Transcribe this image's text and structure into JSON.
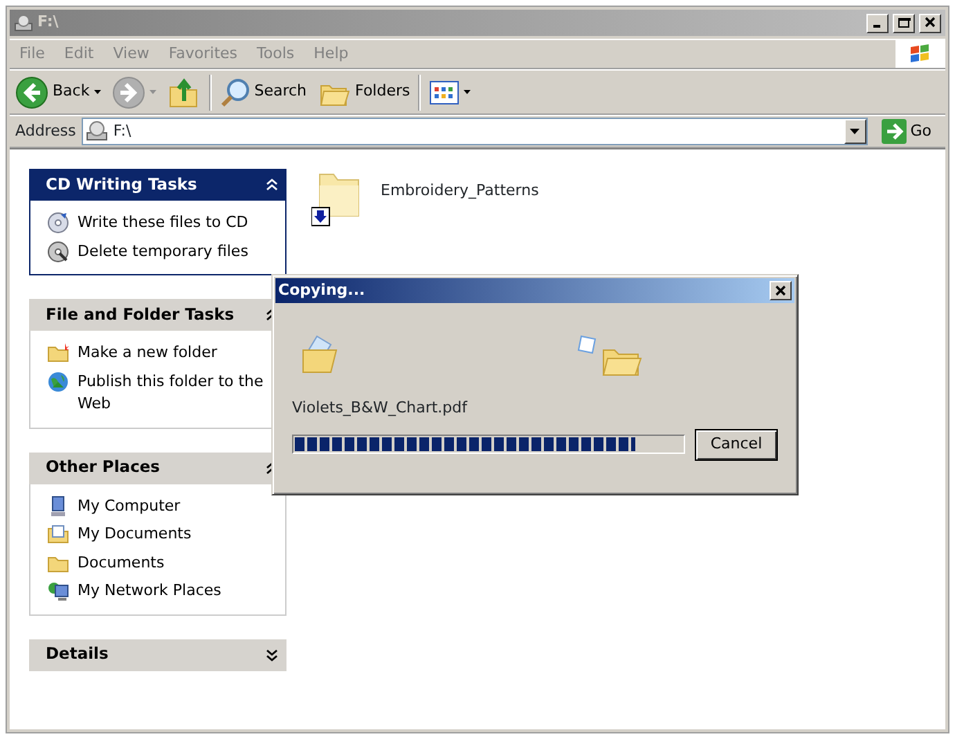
{
  "window": {
    "title": "F:\\",
    "active": false
  },
  "menu": [
    "File",
    "Edit",
    "View",
    "Favorites",
    "Tools",
    "Help"
  ],
  "toolbar": [
    {
      "kind": "back",
      "label": "Back",
      "disabled": false
    },
    {
      "kind": "forward",
      "disabled": true
    },
    {
      "kind": "up"
    },
    {
      "kind": "search",
      "label": "Search"
    },
    {
      "kind": "folders",
      "label": "Folders"
    },
    {
      "kind": "views"
    }
  ],
  "address": {
    "label": "Address",
    "value": "F:\\",
    "go": "Go"
  },
  "panels": [
    {
      "title": "CD Writing Tasks",
      "kind": "special",
      "expanded": true,
      "items": [
        {
          "label": "Write these files to CD"
        },
        {
          "label": "Delete temporary files"
        }
      ]
    },
    {
      "title": "File and Folder Tasks",
      "kind": "normal",
      "expanded": true,
      "items": [
        {
          "label": "Make a new folder"
        },
        {
          "label": "Publish this folder to the Web"
        }
      ]
    },
    {
      "title": "Other Places",
      "kind": "normal",
      "expanded": true,
      "items": [
        {
          "label": "My Computer"
        },
        {
          "label": "My Documents"
        },
        {
          "label": "Documents"
        },
        {
          "label": "My Network Places"
        }
      ]
    },
    {
      "title": "Details",
      "kind": "normal",
      "expanded": false
    }
  ],
  "files": [
    {
      "name": "Embroidery_Patterns",
      "pending": true
    }
  ],
  "dialog": {
    "title": "Copying...",
    "file": "Violets_B&W_Chart.pdf",
    "level": 0.88,
    "button": "Cancel"
  }
}
